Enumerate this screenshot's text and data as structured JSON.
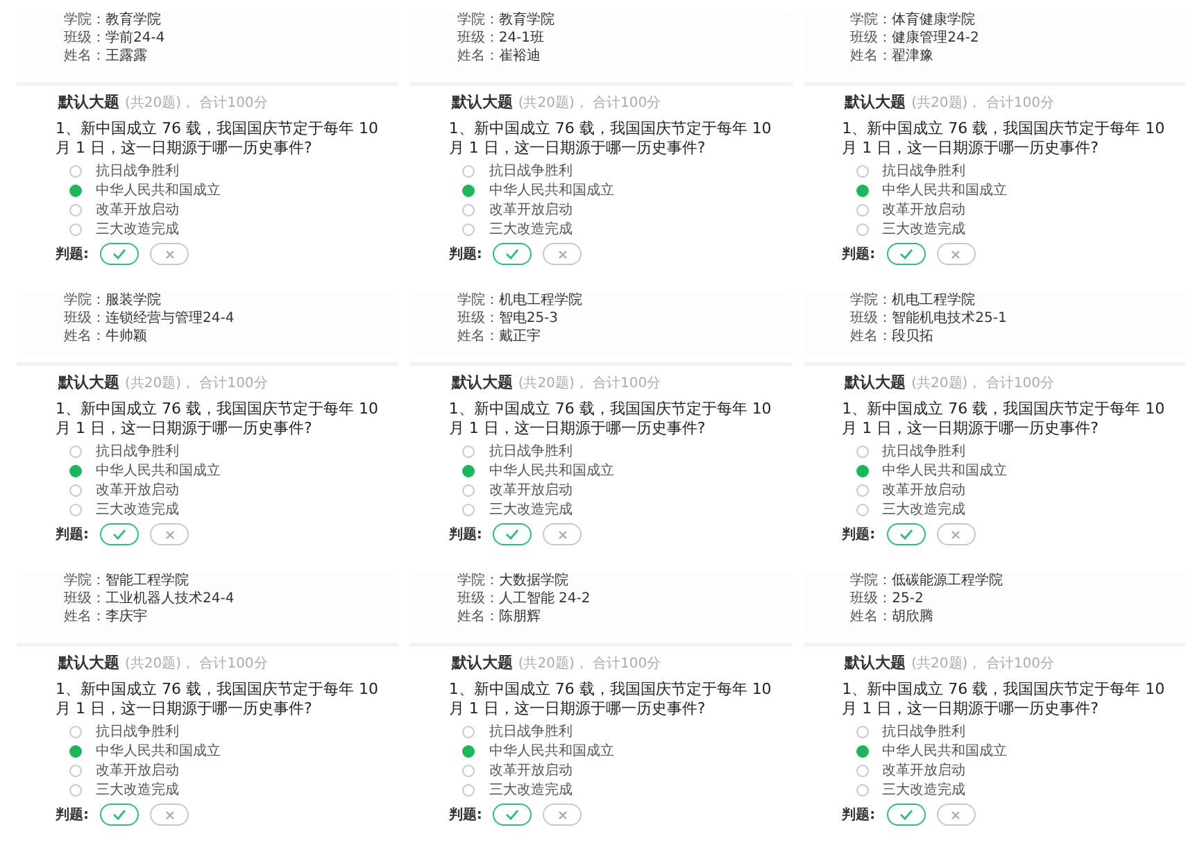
{
  "panels": [
    {
      "info": [
        {
          "label": "学院：",
          "value": "教育学院"
        },
        {
          "label": "班级：",
          "value": "学前24-4"
        },
        {
          "label": "姓名：",
          "value": "王露露"
        }
      ],
      "section": {
        "title": "默认大题",
        "summary": "(共20题)， 合计100分"
      },
      "question": "1、新中国成立 76 载，我国国庆节定于每年 10 月 1 日，这一日期源于哪一历史事件?",
      "options": [
        {
          "label": "抗日战争胜利",
          "selected": false
        },
        {
          "label": "中华人民共和国成立",
          "selected": true
        },
        {
          "label": "改革开放启动",
          "selected": false
        },
        {
          "label": "三大改造完成",
          "selected": false
        }
      ],
      "judge": {
        "label": "判题:",
        "verdicts": [
          {
            "kind": "correct",
            "selected": true
          },
          {
            "kind": "wrong",
            "selected": false
          }
        ]
      }
    },
    {
      "info": [
        {
          "label": "学院：",
          "value": "教育学院"
        },
        {
          "label": "班级：",
          "value": "24-1班"
        },
        {
          "label": "姓名：",
          "value": "崔裕迪"
        }
      ],
      "section": {
        "title": "默认大题",
        "summary": "(共20题)， 合计100分"
      },
      "question": "1、新中国成立 76 载，我国国庆节定于每年 10 月 1 日，这一日期源于哪一历史事件?",
      "options": [
        {
          "label": "抗日战争胜利",
          "selected": false
        },
        {
          "label": "中华人民共和国成立",
          "selected": true
        },
        {
          "label": "改革开放启动",
          "selected": false
        },
        {
          "label": "三大改造完成",
          "selected": false
        }
      ],
      "judge": {
        "label": "判题:",
        "verdicts": [
          {
            "kind": "correct",
            "selected": true
          },
          {
            "kind": "wrong",
            "selected": false
          }
        ]
      }
    },
    {
      "info": [
        {
          "label": "学院：",
          "value": "体育健康学院"
        },
        {
          "label": "班级：",
          "value": "健康管理24-2"
        },
        {
          "label": "姓名：",
          "value": "翟津豫"
        }
      ],
      "section": {
        "title": "默认大题",
        "summary": "(共20题)， 合计100分"
      },
      "question": "1、新中国成立 76 载，我国国庆节定于每年 10 月 1 日，这一日期源于哪一历史事件?",
      "options": [
        {
          "label": "抗日战争胜利",
          "selected": false
        },
        {
          "label": "中华人民共和国成立",
          "selected": true
        },
        {
          "label": "改革开放启动",
          "selected": false
        },
        {
          "label": "三大改造完成",
          "selected": false
        }
      ],
      "judge": {
        "label": "判题:",
        "verdicts": [
          {
            "kind": "correct",
            "selected": true
          },
          {
            "kind": "wrong",
            "selected": false
          }
        ]
      }
    },
    {
      "info": [
        {
          "label": "学院：",
          "value": "服装学院"
        },
        {
          "label": "班级：",
          "value": "连锁经营与管理24-4"
        },
        {
          "label": "姓名：",
          "value": "牛帅颖"
        }
      ],
      "section": {
        "title": "默认大题",
        "summary": "(共20题)， 合计100分"
      },
      "question": "1、新中国成立 76 载，我国国庆节定于每年 10 月 1 日，这一日期源于哪一历史事件?",
      "options": [
        {
          "label": "抗日战争胜利",
          "selected": false
        },
        {
          "label": "中华人民共和国成立",
          "selected": true
        },
        {
          "label": "改革开放启动",
          "selected": false
        },
        {
          "label": "三大改造完成",
          "selected": false
        }
      ],
      "judge": {
        "label": "判题:",
        "verdicts": [
          {
            "kind": "correct",
            "selected": true
          },
          {
            "kind": "wrong",
            "selected": false
          }
        ]
      }
    },
    {
      "info": [
        {
          "label": "学院：",
          "value": "机电工程学院"
        },
        {
          "label": "班级：",
          "value": "智电25-3"
        },
        {
          "label": "姓名：",
          "value": "戴正宇"
        }
      ],
      "section": {
        "title": "默认大题",
        "summary": "(共20题)， 合计100分"
      },
      "question": "1、新中国成立 76 载，我国国庆节定于每年 10 月 1 日，这一日期源于哪一历史事件?",
      "options": [
        {
          "label": "抗日战争胜利",
          "selected": false
        },
        {
          "label": "中华人民共和国成立",
          "selected": true
        },
        {
          "label": "改革开放启动",
          "selected": false
        },
        {
          "label": "三大改造完成",
          "selected": false
        }
      ],
      "judge": {
        "label": "判题:",
        "verdicts": [
          {
            "kind": "correct",
            "selected": true
          },
          {
            "kind": "wrong",
            "selected": false
          }
        ]
      }
    },
    {
      "info": [
        {
          "label": "学院：",
          "value": "机电工程学院"
        },
        {
          "label": "班级：",
          "value": "智能机电技术25-1"
        },
        {
          "label": "姓名：",
          "value": "段贝拓"
        }
      ],
      "section": {
        "title": "默认大题",
        "summary": "(共20题)， 合计100分"
      },
      "question": "1、新中国成立 76 载，我国国庆节定于每年 10 月 1 日，这一日期源于哪一历史事件?",
      "options": [
        {
          "label": "抗日战争胜利",
          "selected": false
        },
        {
          "label": "中华人民共和国成立",
          "selected": true
        },
        {
          "label": "改革开放启动",
          "selected": false
        },
        {
          "label": "三大改造完成",
          "selected": false
        }
      ],
      "judge": {
        "label": "判题:",
        "verdicts": [
          {
            "kind": "correct",
            "selected": true
          },
          {
            "kind": "wrong",
            "selected": false
          }
        ]
      }
    },
    {
      "info": [
        {
          "label": "学院：",
          "value": "智能工程学院"
        },
        {
          "label": "班级：",
          "value": "工业机器人技术24-4"
        },
        {
          "label": "姓名：",
          "value": "李庆宇"
        }
      ],
      "section": {
        "title": "默认大题",
        "summary": "(共20题)， 合计100分"
      },
      "question": "1、新中国成立 76 载，我国国庆节定于每年 10 月 1 日，这一日期源于哪一历史事件?",
      "options": [
        {
          "label": "抗日战争胜利",
          "selected": false
        },
        {
          "label": "中华人民共和国成立",
          "selected": true
        },
        {
          "label": "改革开放启动",
          "selected": false
        },
        {
          "label": "三大改造完成",
          "selected": false
        }
      ],
      "judge": {
        "label": "判题:",
        "verdicts": [
          {
            "kind": "correct",
            "selected": true
          },
          {
            "kind": "wrong",
            "selected": false
          }
        ]
      }
    },
    {
      "info": [
        {
          "label": "学院：",
          "value": "大数据学院"
        },
        {
          "label": "班级：",
          "value": "人工智能 24-2"
        },
        {
          "label": "姓名：",
          "value": "陈朋辉"
        }
      ],
      "section": {
        "title": "默认大题",
        "summary": "(共20题)， 合计100分"
      },
      "question": "1、新中国成立 76 载，我国国庆节定于每年 10 月 1 日，这一日期源于哪一历史事件?",
      "options": [
        {
          "label": "抗日战争胜利",
          "selected": false
        },
        {
          "label": "中华人民共和国成立",
          "selected": true
        },
        {
          "label": "改革开放启动",
          "selected": false
        },
        {
          "label": "三大改造完成",
          "selected": false
        }
      ],
      "judge": {
        "label": "判题:",
        "verdicts": [
          {
            "kind": "correct",
            "selected": true
          },
          {
            "kind": "wrong",
            "selected": false
          }
        ]
      }
    },
    {
      "info": [
        {
          "label": "学院：",
          "value": "低碳能源工程学院"
        },
        {
          "label": "班级：",
          "value": "25-2"
        },
        {
          "label": "姓名：",
          "value": "胡欣腾"
        }
      ],
      "section": {
        "title": "默认大题",
        "summary": "(共20题)， 合计100分"
      },
      "question": "1、新中国成立 76 载，我国国庆节定于每年 10 月 1 日，这一日期源于哪一历史事件?",
      "options": [
        {
          "label": "抗日战争胜利",
          "selected": false
        },
        {
          "label": "中华人民共和国成立",
          "selected": true
        },
        {
          "label": "改革开放启动",
          "selected": false
        },
        {
          "label": "三大改造完成",
          "selected": false
        }
      ],
      "judge": {
        "label": "判题:",
        "verdicts": [
          {
            "kind": "correct",
            "selected": true
          },
          {
            "kind": "wrong",
            "selected": false
          }
        ]
      }
    }
  ]
}
